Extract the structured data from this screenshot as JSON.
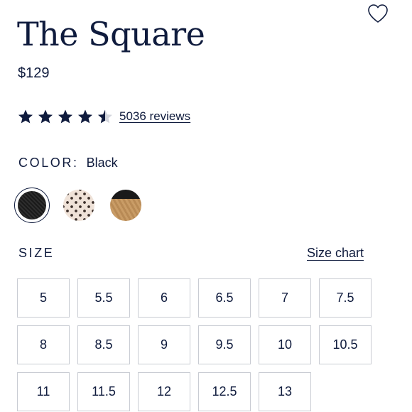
{
  "product": {
    "title": "The Square",
    "price": "$129",
    "rating": 4.5,
    "rating_max": 5,
    "reviews_text": "5036 reviews"
  },
  "color": {
    "label": "COLOR:",
    "selected": "Black",
    "swatches": [
      {
        "name": "black",
        "selected": true
      },
      {
        "name": "cream-with-dots",
        "selected": false
      },
      {
        "name": "tan-with-black-trim",
        "selected": false
      }
    ]
  },
  "size": {
    "label": "SIZE",
    "chart_link": "Size chart",
    "options": [
      "5",
      "5.5",
      "6",
      "6.5",
      "7",
      "7.5",
      "8",
      "8.5",
      "9",
      "9.5",
      "10",
      "10.5",
      "11",
      "11.5",
      "12",
      "12.5",
      "13"
    ]
  },
  "icons": {
    "favorite": "heart-outline-icon",
    "rating": "star-icon"
  },
  "colors": {
    "text": "#0f1b3d",
    "border": "#c9ccd3",
    "star_empty": "#d3d5dc"
  }
}
